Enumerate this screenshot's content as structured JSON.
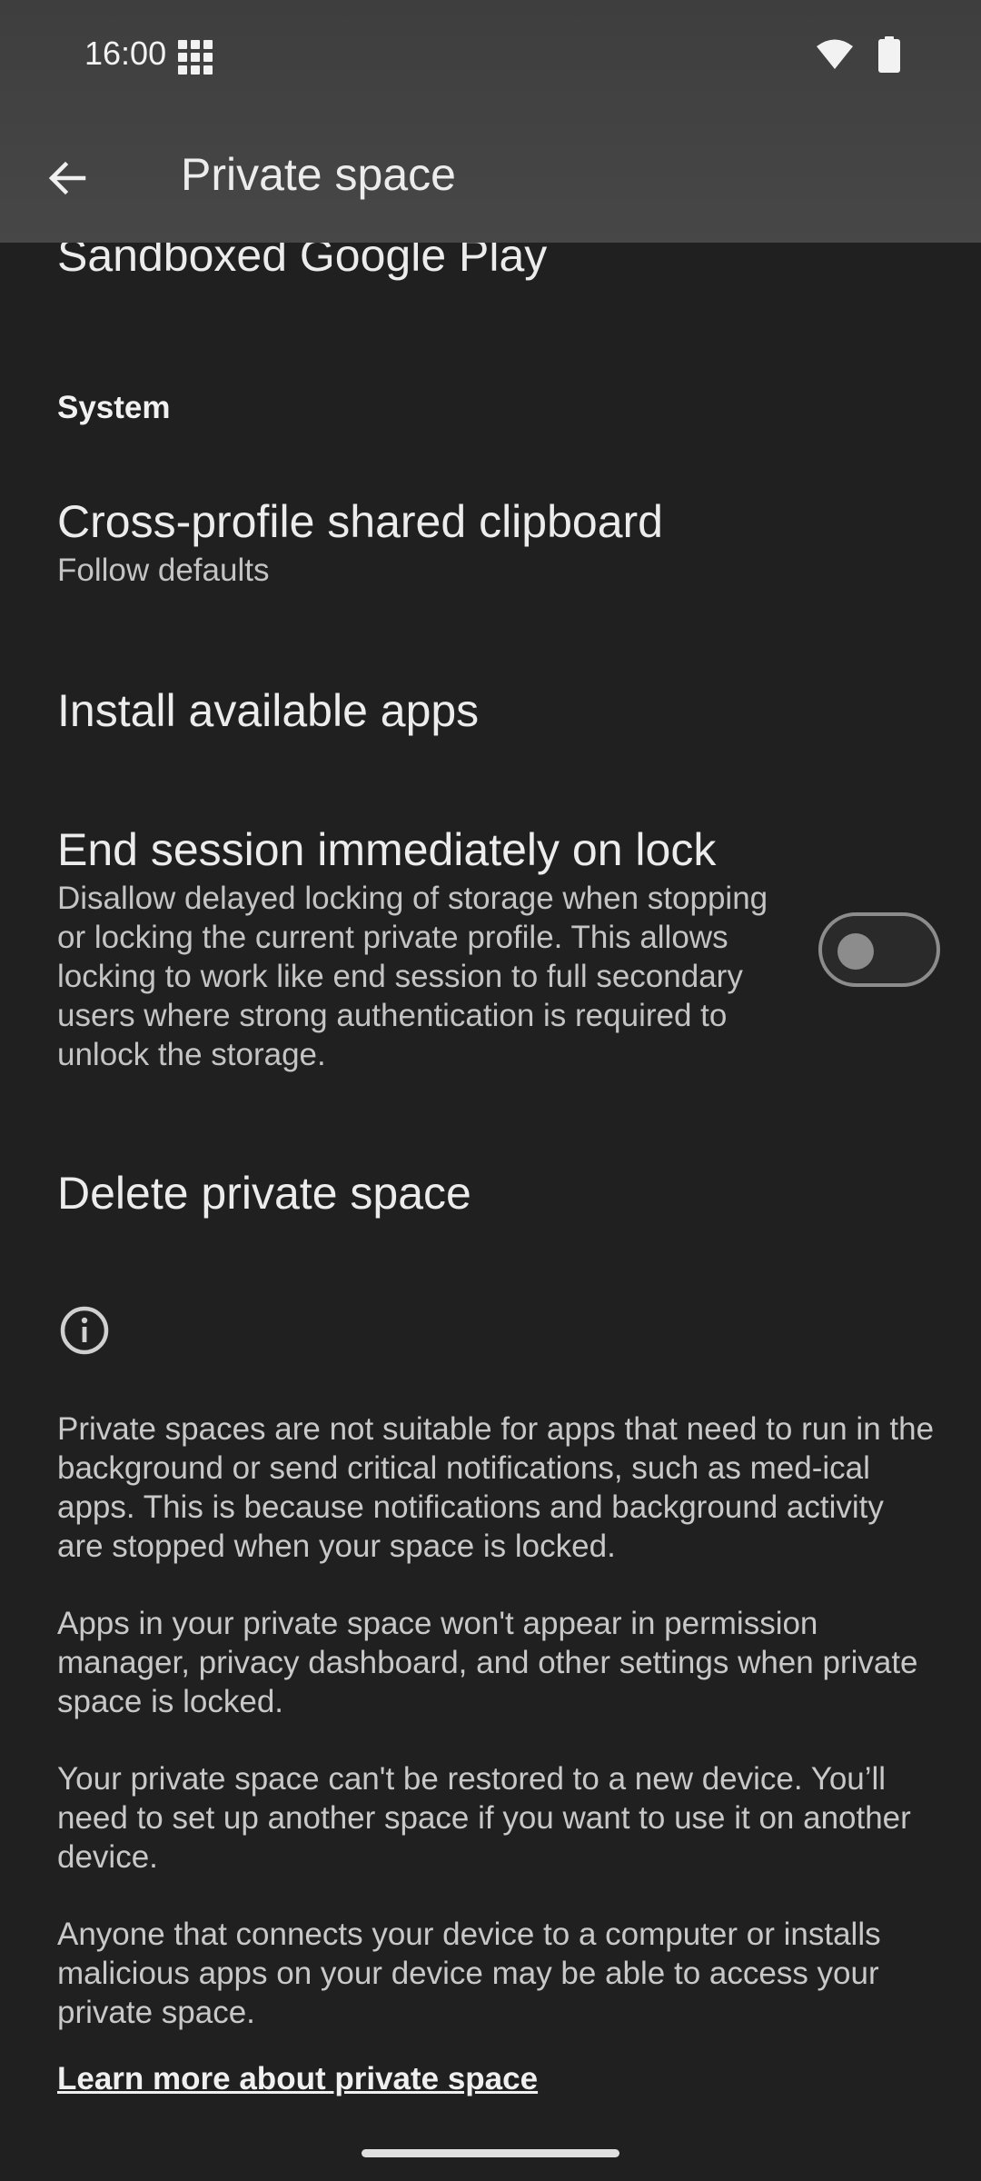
{
  "status_bar": {
    "time": "16:00",
    "icons": [
      "app-grid-icon",
      "wifi-icon",
      "battery-icon"
    ]
  },
  "toolbar": {
    "title": "Private space",
    "back_icon": "arrow-left-icon"
  },
  "partial_item": {
    "label": "Sandboxed Google Play"
  },
  "sections": {
    "system_header": "System"
  },
  "preferences": {
    "clipboard": {
      "title": "Cross-profile shared clipboard",
      "summary": "Follow defaults"
    },
    "install_apps": {
      "title": "Install available apps"
    },
    "end_session": {
      "title": "End session immediately on lock",
      "summary": "Disallow delayed locking of storage when stopping or locking the current private profile. This allows locking to work like end session to full secondary users where strong authentication is required to unlock the storage.",
      "toggle_on": false
    },
    "delete": {
      "title": "Delete private space"
    }
  },
  "footer": {
    "info_icon": "info-icon",
    "paragraphs": [
      "Private spaces are not suitable for apps that need to run in the background or send critical notifications, such as med-ical apps. This is because notifications and background activity are stopped when your space is locked.",
      "Apps in your private space won't appear in permission manager, privacy dashboard, and other settings when private space is locked.",
      "Your private space can't be restored to a new device. You’ll need to set up another space if you want to use it on another device.",
      "Anyone that connects your device to a computer or installs malicious apps on your device may be able to access your private space."
    ],
    "learn_more": "Learn more about private space"
  },
  "colors": {
    "background": "#202020",
    "toolbar": "#444444",
    "text_primary": "#ececec",
    "text_secondary": "#c4c4c4",
    "toggle_off": "#8c8c8c"
  }
}
